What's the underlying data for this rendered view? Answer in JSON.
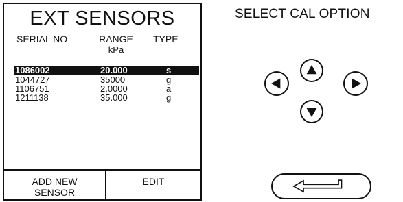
{
  "screen": {
    "title": "EXT SENSORS",
    "columns": {
      "serial": "SERIAL NO",
      "range": "RANGE",
      "range_unit": "kPa",
      "type": "TYPE"
    },
    "rows": [
      {
        "serial": "1086002",
        "range": "20.000",
        "type": "s",
        "selected": true
      },
      {
        "serial": "1044727",
        "range": "35000",
        "type": "g",
        "selected": false
      },
      {
        "serial": "1106751",
        "range": "2.0000",
        "type": "a",
        "selected": false
      },
      {
        "serial": "1211138",
        "range": "35.000",
        "type": "g",
        "selected": false
      }
    ],
    "soft_keys": {
      "left_line1": "ADD NEW",
      "left_line2": "SENSOR",
      "right": "EDIT"
    }
  },
  "controls": {
    "prompt": "SELECT CAL OPTION",
    "buttons": {
      "up": "up-arrow-icon",
      "left": "left-arrow-icon",
      "right": "right-arrow-icon",
      "down": "down-arrow-icon",
      "enter": "enter-arrow-icon"
    }
  },
  "colors": {
    "ink": "#111111",
    "background": "#ffffff",
    "highlight_text": "#ffffff"
  }
}
